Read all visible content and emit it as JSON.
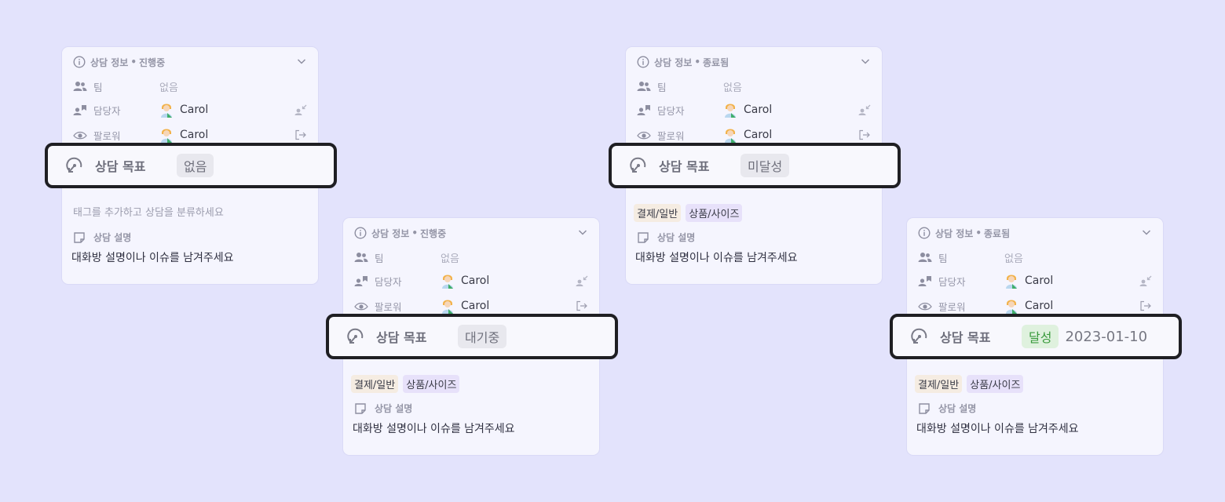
{
  "cards": [
    {
      "header_title": "상담 정보",
      "header_dot": "•",
      "header_state": "진행중",
      "team_label": "팀",
      "team_value": "없음",
      "owner_label": "담당자",
      "owner_name": "Carol",
      "follower_label": "팔로워",
      "follower_name": "Carol",
      "tag_placeholder": "태그를 추가하고 상담을 분류하세요",
      "tags": [],
      "desc_label": "상담 설명",
      "desc_text": "대화방 설명이나 이슈를 남겨주세요",
      "goal_label": "상담 목표",
      "goal_status": "없음",
      "goal_date": ""
    },
    {
      "header_title": "상담 정보",
      "header_dot": "•",
      "header_state": "진행중",
      "team_label": "팀",
      "team_value": "없음",
      "owner_label": "담당자",
      "owner_name": "Carol",
      "follower_label": "팔로워",
      "follower_name": "Carol",
      "tag_placeholder": "",
      "tags": [
        "결제/일반",
        "상품/사이즈"
      ],
      "desc_label": "상담 설명",
      "desc_text": "대화방 설명이나 이슈를 남겨주세요",
      "goal_label": "상담 목표",
      "goal_status": "대기중",
      "goal_date": ""
    },
    {
      "header_title": "상담 정보",
      "header_dot": "•",
      "header_state": "종료됨",
      "team_label": "팀",
      "team_value": "없음",
      "owner_label": "담당자",
      "owner_name": "Carol",
      "follower_label": "팔로워",
      "follower_name": "Carol",
      "tag_placeholder": "",
      "tags": [
        "결제/일반",
        "상품/사이즈"
      ],
      "desc_label": "상담 설명",
      "desc_text": "대화방 설명이나 이슈를 남겨주세요",
      "goal_label": "상담 목표",
      "goal_status": "미달성",
      "goal_date": ""
    },
    {
      "header_title": "상담 정보",
      "header_dot": "•",
      "header_state": "종료됨",
      "team_label": "팀",
      "team_value": "없음",
      "owner_label": "담당자",
      "owner_name": "Carol",
      "follower_label": "팔로워",
      "follower_name": "Carol",
      "tag_placeholder": "",
      "tags": [
        "결제/일반",
        "상품/사이즈"
      ],
      "desc_label": "상담 설명",
      "desc_text": "대화방 설명이나 이슈를 남겨주세요",
      "goal_label": "상담 목표",
      "goal_status": "달성",
      "goal_date": "2023-01-10"
    }
  ],
  "colors": {
    "page_bg": "#e3e3fc",
    "card_bg": "#f5f5fe",
    "highlight_border": "#1f1f23",
    "status_default_bg": "#e8e8ee",
    "status_achieved_bg": "#dff1de",
    "status_achieved_text": "#3a9a3d",
    "tag_payment_bg": "#f5ece2",
    "tag_size_bg": "#e7e1fa"
  },
  "icons": [
    "info-icon",
    "chevron-down-icon",
    "team-icon",
    "assignee-icon",
    "eye-icon",
    "avatar",
    "collapse-icon",
    "exit-icon",
    "tag-icon",
    "note-icon",
    "goal-icon"
  ]
}
